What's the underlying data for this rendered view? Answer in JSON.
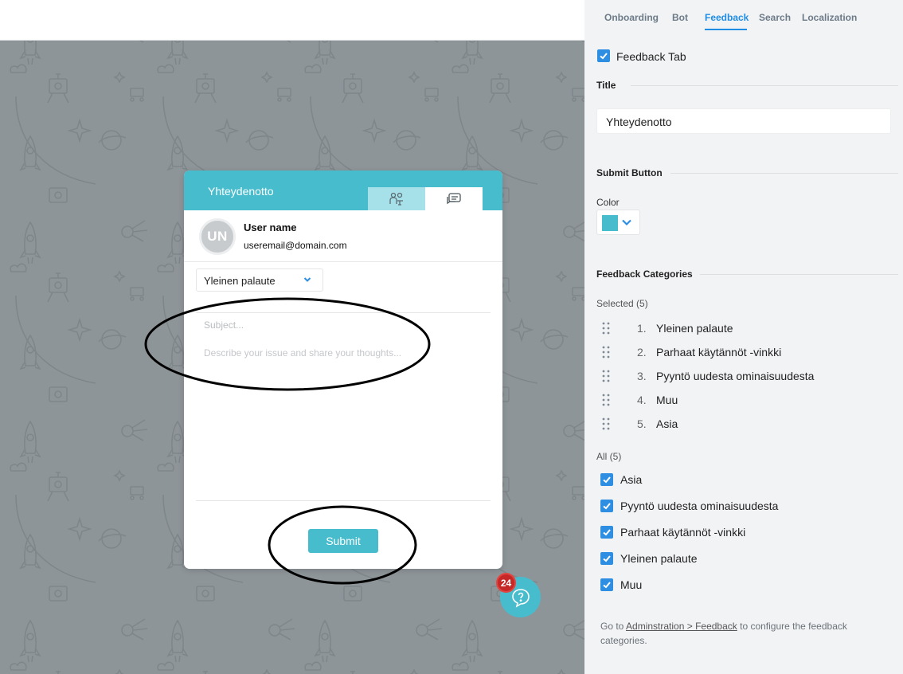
{
  "widget": {
    "title": "Yhteydenotto",
    "user_name": "User name",
    "user_email": "useremail@domain.com",
    "avatar_initials": "UN",
    "category_value": "Yleinen palaute",
    "subject_placeholder": "Subject...",
    "description_placeholder": "Describe your issue and share your thoughts...",
    "submit_label": "Submit",
    "badge_count": "24",
    "accent_color": "#47bccd"
  },
  "panel": {
    "tabs": [
      {
        "label": "Onboarding",
        "active": false
      },
      {
        "label": "Bot",
        "active": false
      },
      {
        "label": "Feedback",
        "active": true
      },
      {
        "label": "Search",
        "active": false
      },
      {
        "label": "Localization",
        "active": false
      }
    ],
    "feedback_tab_label": "Feedback Tab",
    "title_section": "Title",
    "title_value": "Yhteydenotto",
    "submit_section": "Submit Button",
    "color_label": "Color",
    "color_value": "#47bccd",
    "categories_section": "Feedback Categories",
    "selected_label": "Selected (5)",
    "selected": [
      {
        "num": "1.",
        "text": "Yleinen palaute"
      },
      {
        "num": "2.",
        "text": "Parhaat käytännöt -vinkki"
      },
      {
        "num": "3.",
        "text": "Pyyntö uudesta ominaisuudesta"
      },
      {
        "num": "4.",
        "text": "Muu"
      },
      {
        "num": "5.",
        "text": "Asia"
      }
    ],
    "all_label": "All (5)",
    "all": [
      {
        "text": "Asia",
        "checked": true
      },
      {
        "text": "Pyyntö uudesta ominaisuudesta",
        "checked": true
      },
      {
        "text": "Parhaat käytännöt -vinkki",
        "checked": true
      },
      {
        "text": "Yleinen palaute",
        "checked": true
      },
      {
        "text": "Muu",
        "checked": true
      }
    ],
    "footer_prefix": "Go to ",
    "footer_link": "Adminstration > Feedback",
    "footer_suffix": " to configure the feedback categories."
  }
}
